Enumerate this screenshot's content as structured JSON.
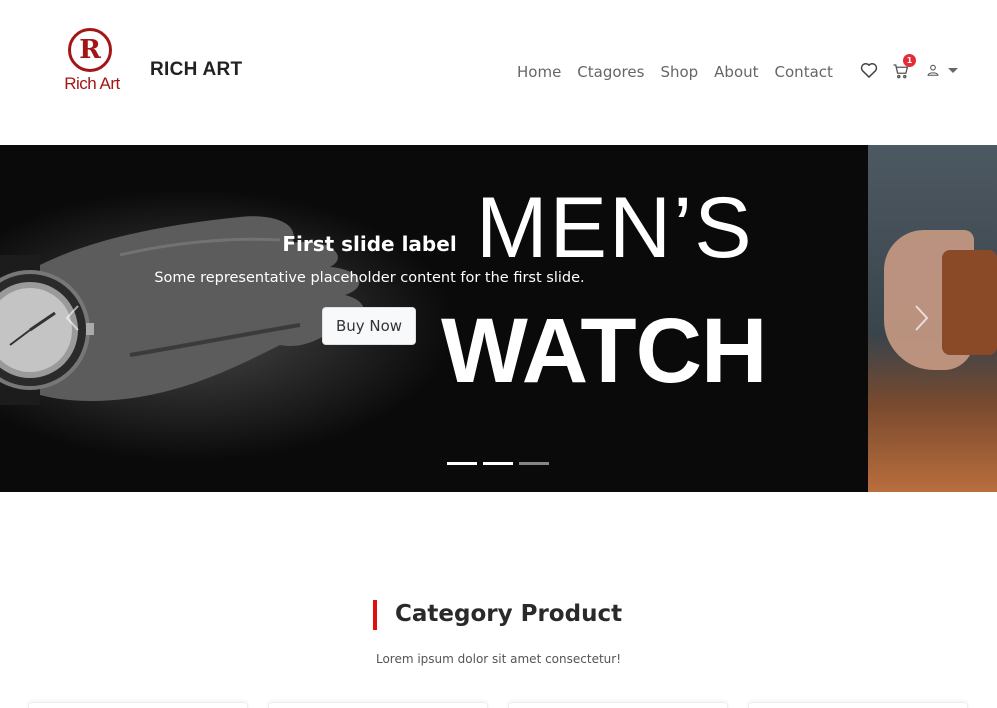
{
  "header": {
    "logo_letter": "R",
    "logo_text": "Rich Art",
    "brand": "RICH ART",
    "nav": [
      "Home",
      "Ctagores",
      "Shop",
      "About",
      "Contact"
    ],
    "icons": [
      "heart-icon",
      "cart-icon",
      "user-icon",
      "caret-down-icon"
    ],
    "cart_count": "1"
  },
  "carousel": {
    "banner_line_1": "MEN’S",
    "banner_line_2": "WATCH",
    "caption_title": "First slide label",
    "caption_text": "Some representative placeholder content for the first slide.",
    "button_label": "Buy Now",
    "indicators": 3,
    "active_index": 0
  },
  "category": {
    "title": "Category Product",
    "subtitle": "Lorem ipsum dolor sit amet consectetur!",
    "accent_color": "#e10f0f"
  },
  "colors": {
    "brand_red": "#a31616",
    "badge_red": "#e52b38",
    "nav_text": "#666666"
  }
}
